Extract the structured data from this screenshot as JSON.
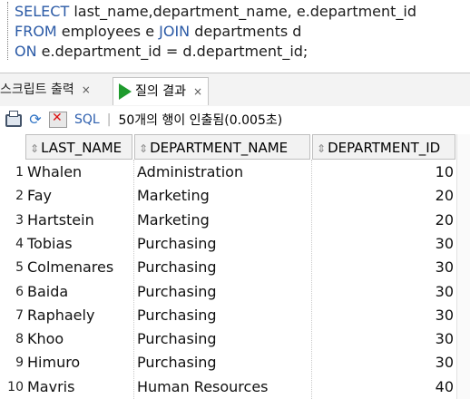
{
  "editor": {
    "line1": {
      "kw": "SELECT",
      "text": " last_name,department_name, e.department_id"
    },
    "line2": {
      "kw": "FROM",
      "text": " employees e ",
      "kw2": "JOIN",
      "text2": " departments d"
    },
    "line3": {
      "kw": "ON",
      "text": " e.department_id = d.department_id;"
    }
  },
  "tabs": [
    {
      "label": "스크립트 출력",
      "close": "×"
    },
    {
      "label": "질의 결과",
      "close": "×"
    }
  ],
  "toolbar": {
    "sql_label": "SQL",
    "separator": "|",
    "status": "50개의 행이 인출됨(0.005초)"
  },
  "columns": [
    "LAST_NAME",
    "DEPARTMENT_NAME",
    "DEPARTMENT_ID"
  ],
  "rows": [
    {
      "n": "1",
      "last_name": "Whalen",
      "department_name": "Administration",
      "department_id": "10"
    },
    {
      "n": "2",
      "last_name": "Fay",
      "department_name": "Marketing",
      "department_id": "20"
    },
    {
      "n": "3",
      "last_name": "Hartstein",
      "department_name": "Marketing",
      "department_id": "20"
    },
    {
      "n": "4",
      "last_name": "Tobias",
      "department_name": "Purchasing",
      "department_id": "30"
    },
    {
      "n": "5",
      "last_name": "Colmenares",
      "department_name": "Purchasing",
      "department_id": "30"
    },
    {
      "n": "6",
      "last_name": "Baida",
      "department_name": "Purchasing",
      "department_id": "30"
    },
    {
      "n": "7",
      "last_name": "Raphaely",
      "department_name": "Purchasing",
      "department_id": "30"
    },
    {
      "n": "8",
      "last_name": "Khoo",
      "department_name": "Purchasing",
      "department_id": "30"
    },
    {
      "n": "9",
      "last_name": "Himuro",
      "department_name": "Purchasing",
      "department_id": "30"
    },
    {
      "n": "10",
      "last_name": "Mavris",
      "department_name": "Human Resources",
      "department_id": "40"
    }
  ]
}
